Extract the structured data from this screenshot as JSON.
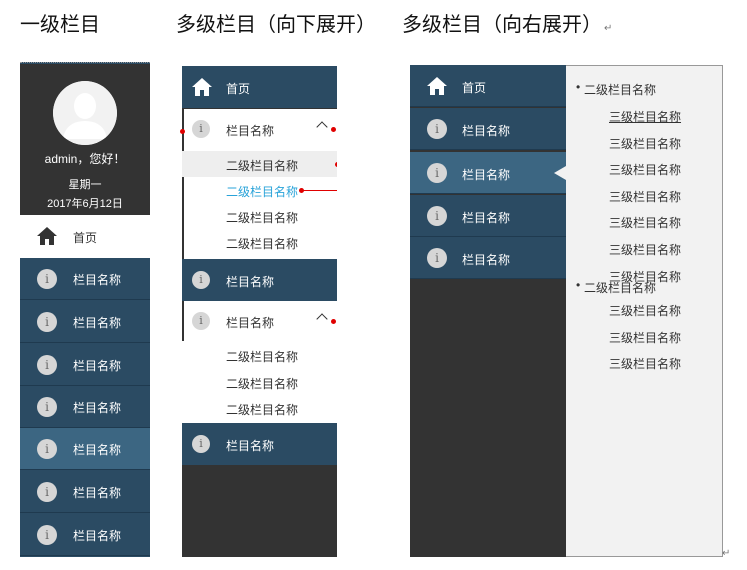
{
  "headings": {
    "single": "一级栏目",
    "multi_down": "多级栏目（向下展开）",
    "multi_right": "多级栏目（向右展开）",
    "return_mark": "↵"
  },
  "panel1": {
    "greeting": "admin，您好！",
    "weekday": "星期一",
    "date": "2017年6月12日",
    "home_label": "首页",
    "items": [
      "栏目名称",
      "栏目名称",
      "栏目名称",
      "栏目名称",
      "栏目名称",
      "栏目名称",
      "栏目名称"
    ],
    "active_index": 4
  },
  "panel2": {
    "home_label": "首页",
    "group1": {
      "label": "栏目名称",
      "subs": [
        "二级栏目名称",
        "二级栏目名称",
        "二级栏目名称",
        "二级栏目名称"
      ],
      "highlight_index": 0,
      "selected_index": 1
    },
    "item_mid": "栏目名称",
    "group2": {
      "label": "栏目名称",
      "subs": [
        "二级栏目名称",
        "二级栏目名称",
        "二级栏目名称"
      ]
    },
    "item_last": "栏目名称"
  },
  "panel3": {
    "home_label": "首页",
    "items": [
      "栏目名称",
      "栏目名称",
      "栏目名称",
      "栏目名称"
    ],
    "active_index": 1,
    "flyout": {
      "group1": "二级栏目名称",
      "group1_items": [
        "三级栏目名称",
        "三级栏目名称",
        "三级栏目名称",
        "三级栏目名称",
        "三级栏目名称",
        "三级栏目名称",
        "三级栏目名称"
      ],
      "group2": "二级栏目名称",
      "group2_items": [
        "三级栏目名称",
        "三级栏目名称",
        "三级栏目名称"
      ]
    }
  },
  "colors": {
    "nav_bg": "#2b4b63",
    "nav_active": "#3c6682",
    "profile_bg": "#333333",
    "selected_text": "#29a3d9",
    "marker_red": "#e00000"
  }
}
